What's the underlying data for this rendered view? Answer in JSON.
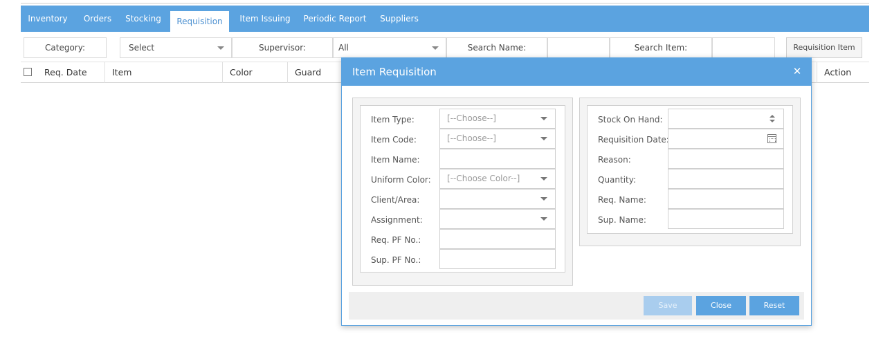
{
  "nav": {
    "tabs": [
      {
        "label": "Inventory"
      },
      {
        "label": "Orders"
      },
      {
        "label": "Stocking"
      },
      {
        "label": "Requisition",
        "active": true
      },
      {
        "label": "Item Issuing"
      },
      {
        "label": "Periodic Report"
      },
      {
        "label": "Suppliers"
      }
    ]
  },
  "filters": {
    "category_label": "Category:",
    "category_value": "Select",
    "supervisor_label": "Supervisor:",
    "supervisor_value": "All",
    "search_name_label": "Search Name:",
    "search_name_value": "",
    "search_item_label": "Search Item:",
    "search_item_value": "",
    "requisition_button": "Requisition Item"
  },
  "grid": {
    "columns": [
      "Req. Date",
      "Item",
      "Color",
      "Guard",
      "Action"
    ]
  },
  "modal": {
    "title": "Item Requisition",
    "left": {
      "item_type_label": "Item Type:",
      "item_type_value": "[--Choose--]",
      "item_code_label": "Item Code:",
      "item_code_value": "[--Choose--]",
      "item_name_label": "Item Name:",
      "item_name_value": "",
      "uniform_color_label": "Uniform Color:",
      "uniform_color_value": "[--Choose Color--]",
      "client_area_label": "Client/Area:",
      "client_area_value": "",
      "assignment_label": "Assignment:",
      "assignment_value": "",
      "req_pf_label": "Req. PF No.:",
      "req_pf_value": "",
      "sup_pf_label": "Sup. PF No.:",
      "sup_pf_value": ""
    },
    "right": {
      "stock_label": "Stock On Hand:",
      "stock_value": "",
      "req_date_label": "Requisition Date:",
      "req_date_value": "",
      "reason_label": "Reason:",
      "reason_value": "",
      "quantity_label": "Quantity:",
      "quantity_value": "",
      "req_name_label": "Req. Name:",
      "req_name_value": "",
      "sup_name_label": "Sup. Name:",
      "sup_name_value": ""
    },
    "buttons": {
      "save": "Save",
      "close": "Close",
      "reset": "Reset"
    }
  },
  "colors": {
    "accent": "#5ba3e0",
    "accent_disabled": "#a9cdee"
  }
}
